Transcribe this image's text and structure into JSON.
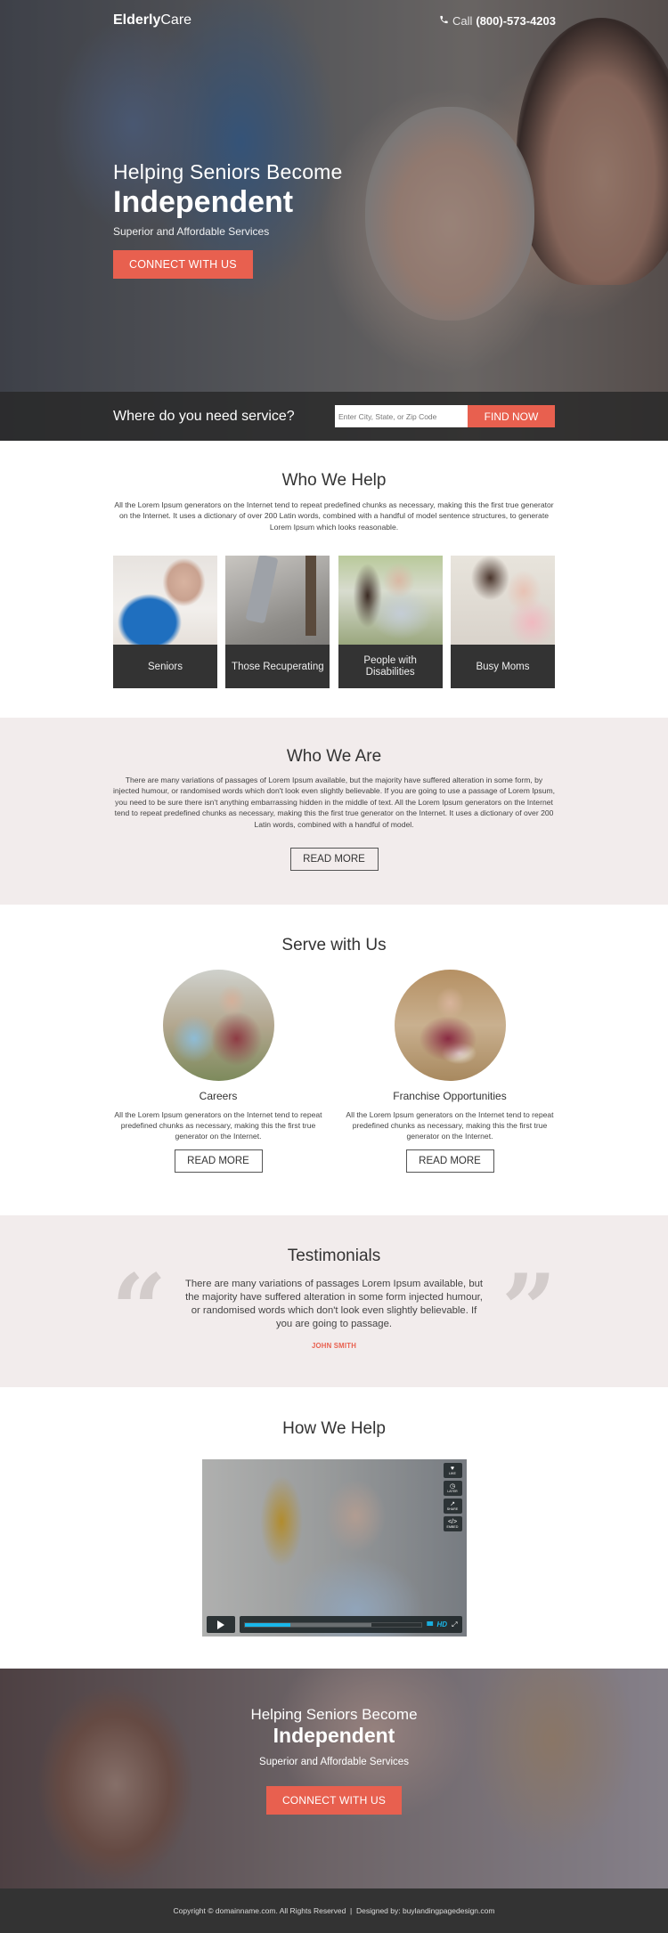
{
  "brand": {
    "logo_bold": "Elderly",
    "logo_light": "Care",
    "accent_color": "#e8604f"
  },
  "header": {
    "call_label": "Call",
    "phone": "(800)-573-4203",
    "phone_icon": "phone-icon"
  },
  "hero": {
    "line1": "Helping Seniors Become",
    "line2": "Independent",
    "line3": "Superior and Affordable Services",
    "cta_label": "CONNECT WITH US"
  },
  "search": {
    "question": "Where do you need service?",
    "placeholder": "Enter City, State, or Zip Code",
    "value": "",
    "button_label": "FIND NOW"
  },
  "who_we_help": {
    "title": "Who We Help",
    "text": "All the Lorem Ipsum generators on the Internet tend to repeat predefined chunks as necessary, making this the first true generator on the Internet. It uses a dictionary of over 200 Latin words, combined with a handful of model sentence structures, to generate Lorem Ipsum which looks reasonable.",
    "cards": [
      {
        "label": "Seniors"
      },
      {
        "label": "Those Recuperating"
      },
      {
        "label": "People with Disabilities"
      },
      {
        "label": "Busy Moms"
      }
    ]
  },
  "who_we_are": {
    "title": "Who We Are",
    "text": "There are many variations of passages of Lorem Ipsum available, but the majority have suffered alteration in some form, by injected humour, or randomised words which don't look even slightly believable. If you are going to use a passage of Lorem Ipsum, you need to be sure there isn't anything embarrassing hidden in the middle of text. All the Lorem Ipsum generators on the Internet tend to repeat predefined chunks as necessary, making this the first true generator on the Internet. It uses a dictionary of over 200 Latin words, combined with a handful of model.",
    "button_label": "READ MORE"
  },
  "serve_with_us": {
    "title": "Serve with Us",
    "items": [
      {
        "title": "Careers",
        "text": "All the Lorem Ipsum generators on the Internet tend to repeat predefined chunks as necessary, making this the first true generator on the Internet.",
        "button_label": "READ MORE"
      },
      {
        "title": "Franchise Opportunities",
        "text": "All the Lorem Ipsum generators on the Internet tend to repeat predefined chunks as necessary, making this the first true generator on the Internet.",
        "button_label": "READ MORE"
      }
    ]
  },
  "testimonials": {
    "title": "Testimonials",
    "quote_open": "“",
    "quote_close": "”",
    "text": "There are many variations of passages Lorem Ipsum available, but the majority have suffered alteration in some form injected humour, or randomised words which don't look even slightly believable. If you are going to passage.",
    "author": "JOHN SMITH"
  },
  "how_we_help": {
    "title": "How We Help",
    "video": {
      "side_buttons": [
        {
          "icon": "heart-icon",
          "glyph": "♥",
          "label": "LIKE"
        },
        {
          "icon": "clock-icon",
          "glyph": "◷",
          "label": "LATER"
        },
        {
          "icon": "share-icon",
          "glyph": "↗",
          "label": "SHARE"
        },
        {
          "icon": "embed-icon",
          "glyph": "</>",
          "label": "EMBED"
        }
      ],
      "played_fraction": 0.26,
      "buffered_fraction": 0.72,
      "volume_glyph": "IIIIIII",
      "hd_label": "HD",
      "fullscreen_glyph": "⤢"
    }
  },
  "bottom_hero": {
    "line1": "Helping Seniors Become",
    "line2": "Independent",
    "line3": "Superior and Affordable Services",
    "cta_label": "CONNECT WITH US"
  },
  "footer": {
    "text": "Copyright © domainname.com. All Rights Reserved  |  Designed by: buylandingpagedesign.com"
  }
}
